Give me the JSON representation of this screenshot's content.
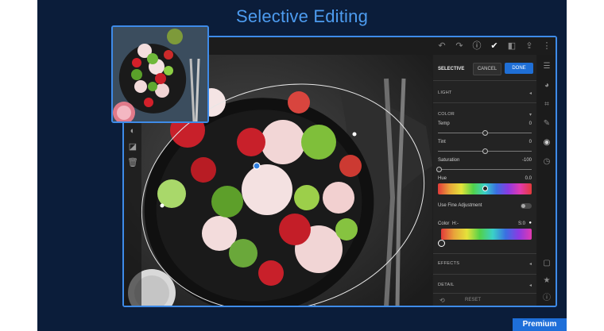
{
  "title": "Selective Editing",
  "badge": "Premium",
  "panel": {
    "mode_label": "SELECTIVE",
    "cancel_label": "CANCEL",
    "done_label": "DONE",
    "sections": {
      "light": "LIGHT",
      "color": "COLOR",
      "effects": "EFFECTS",
      "detail": "DETAIL"
    },
    "sliders": [
      {
        "label": "Temp",
        "value": "0",
        "position": 0.5
      },
      {
        "label": "Tint",
        "value": "0",
        "position": 0.5
      },
      {
        "label": "Saturation",
        "value": "-100",
        "position": 0.0
      }
    ],
    "hue": {
      "label": "Hue",
      "value": "0.0",
      "position": 0.5
    },
    "fine_adjust_label": "Use Fine Adjustment",
    "color_row": {
      "label": "Color",
      "h_value": "H:-",
      "s_value": "S:0"
    },
    "reset_label": "RESET"
  },
  "icons": {
    "topbar": [
      "undo-icon",
      "redo-icon",
      "info-icon",
      "check-circle-icon",
      "compare-icon",
      "share-icon",
      "more-icon"
    ],
    "leftbar": [
      "brush-tool-icon",
      "gradient-tool-icon",
      "delete-icon"
    ],
    "rail": [
      "sliders-icon",
      "presets-icon",
      "crop-icon",
      "healing-icon",
      "selective-icon",
      "history-icon",
      "comment-icon",
      "star-icon",
      "info-icon"
    ]
  },
  "colors": {
    "accent": "#3e8be8",
    "done_button": "#1f6fd6",
    "background": "#0b1d3a"
  }
}
